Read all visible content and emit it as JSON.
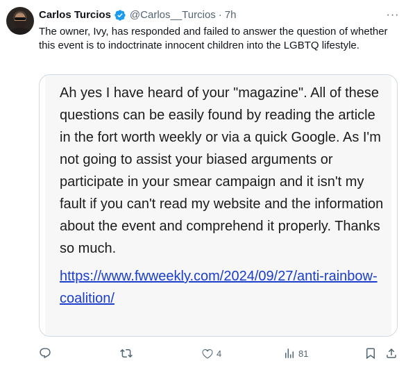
{
  "author": {
    "name": "Carlos Turcios",
    "handle": "@Carlos__Turcios",
    "separator": "·",
    "time": "7h"
  },
  "tweet": {
    "text": "The owner, Ivy, has responded and failed to answer the question of whether this event is to indoctrinate innocent children into the LGBTQ lifestyle."
  },
  "media": {
    "text": "Ah yes I have heard of your \"magazine\". All of these questions can be easily found by reading the article in the fort worth weekly or via a quick Google. As I'm not going to assist your biased arguments or participate in your smear campaign and it isn't my fault if you can't read my website and the information about the event and comprehend it properly. Thanks so much.",
    "link": "https://www.fwweekly.com/2024/09/27/anti-rainbow-coalition/"
  },
  "more_label": "···",
  "actions": {
    "reply_count": "",
    "repost_count": "",
    "like_count": "4",
    "views_count": "81"
  },
  "icons": {
    "verified": "verified-badge-icon",
    "reply": "reply-icon",
    "repost": "repost-icon",
    "like": "heart-icon",
    "views": "views-icon",
    "bookmark": "bookmark-icon",
    "share": "share-icon"
  },
  "colors": {
    "verified": "#1d9bf0",
    "muted": "#536471",
    "link": "#1a3ec9",
    "text": "#0f1419"
  }
}
